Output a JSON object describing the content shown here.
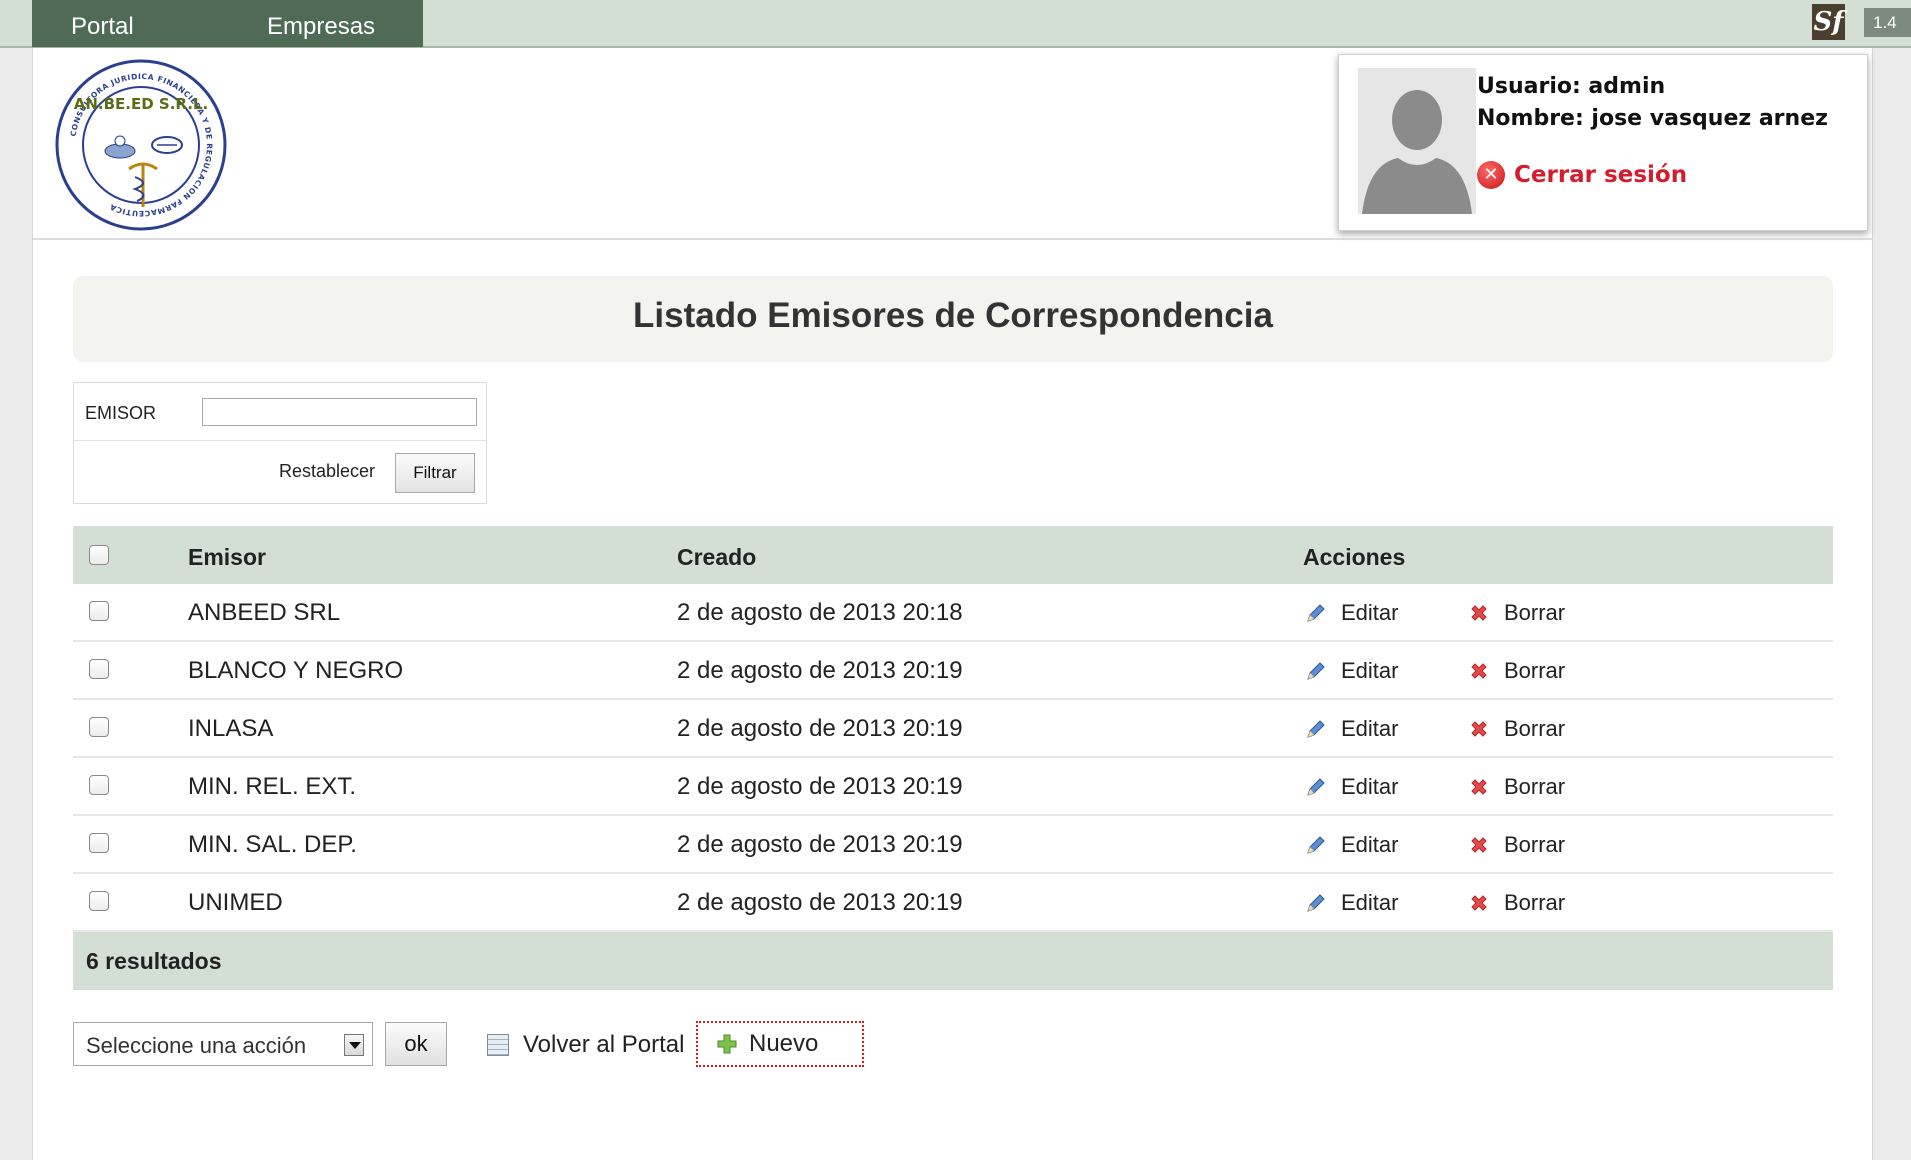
{
  "nav": {
    "portal": "Portal",
    "empresas": "Empresas",
    "sf_badge": "Sf",
    "version": "1.4"
  },
  "logo": {
    "name": "AN.BE.ED S.R.L."
  },
  "user": {
    "usuario_line": "Usuario: admin",
    "nombre_line": "Nombre: jose vasquez arnez",
    "logout_label": "Cerrar sesión"
  },
  "page": {
    "title": "Listado Emisores de Correspondencia"
  },
  "filter": {
    "label": "EMISOR",
    "value": "",
    "reset_label": "Restablecer",
    "submit_label": "Filtrar"
  },
  "table": {
    "headers": {
      "emisor": "Emisor",
      "creado": "Creado",
      "acciones": "Acciones"
    },
    "rows": [
      {
        "emisor": "ANBEED SRL",
        "creado": "2 de agosto de 2013 20:18",
        "edit": "Editar",
        "delete": "Borrar"
      },
      {
        "emisor": "BLANCO Y NEGRO",
        "creado": "2 de agosto de 2013 20:19",
        "edit": "Editar",
        "delete": "Borrar"
      },
      {
        "emisor": "INLASA",
        "creado": "2 de agosto de 2013 20:19",
        "edit": "Editar",
        "delete": "Borrar"
      },
      {
        "emisor": "MIN. REL. EXT.",
        "creado": "2 de agosto de 2013 20:19",
        "edit": "Editar",
        "delete": "Borrar"
      },
      {
        "emisor": "MIN. SAL. DEP.",
        "creado": "2 de agosto de 2013 20:19",
        "edit": "Editar",
        "delete": "Borrar"
      },
      {
        "emisor": "UNIMED",
        "creado": "2 de agosto de 2013 20:19",
        "edit": "Editar",
        "delete": "Borrar"
      }
    ],
    "footer": "6 resultados"
  },
  "actions": {
    "select_value": "Seleccione una acción",
    "ok_label": "ok",
    "volver_label": "Volver al Portal",
    "nuevo_label": "Nuevo"
  },
  "icons": {
    "edit": "pencil-icon",
    "delete": "cross-icon",
    "logout": "close-circle-icon",
    "volver": "list-icon",
    "nuevo": "plus-icon"
  },
  "colors": {
    "nav_bg": "#4f6b56",
    "topbar_bg": "#d3dfd5",
    "table_header_bg": "#d3dfd5",
    "logout_red": "#d31d2d",
    "nuevo_border": "#d41b1b"
  }
}
